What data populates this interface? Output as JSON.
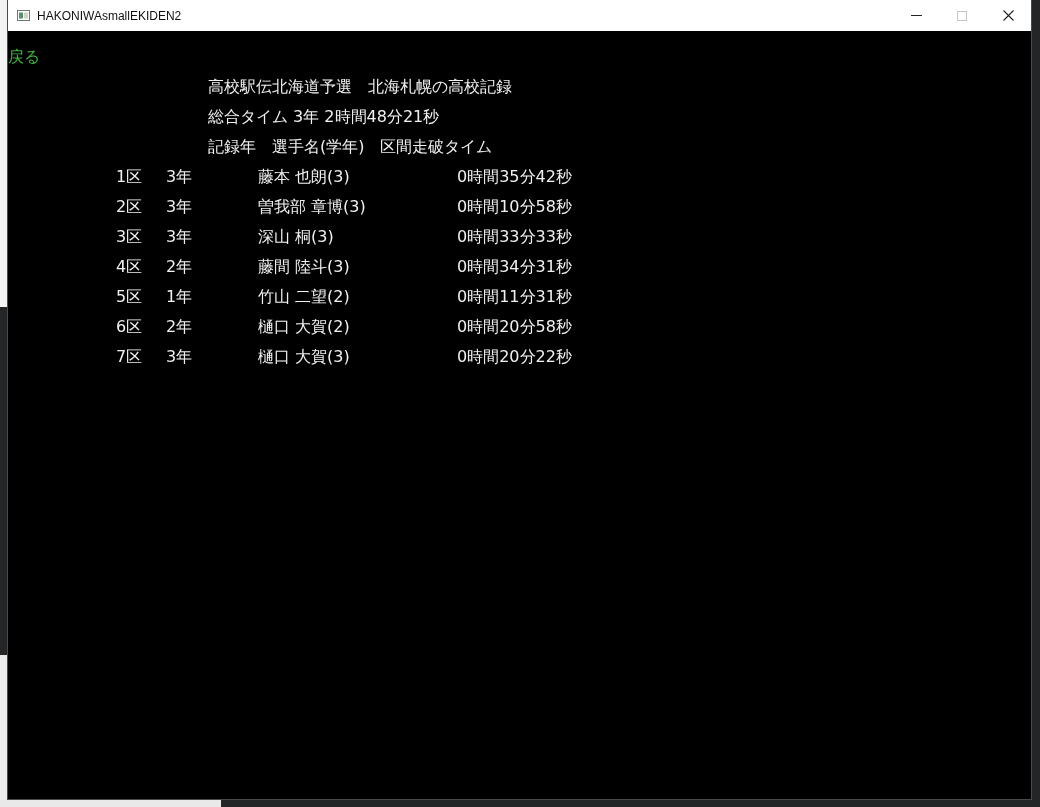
{
  "window": {
    "title": "HAKONIWAsmallEKIDEN2",
    "maximize_disabled": true
  },
  "back_link": "戻る",
  "header": {
    "title": "高校駅伝北海道予選　北海札幌の高校記録",
    "total": "総合タイム 3年 2時間48分21秒",
    "columns": "記録年　選手名(学年)　区間走破タイム"
  },
  "rows": [
    {
      "section": "1区",
      "grade": "3年",
      "runner": "藤本 也朗(3)",
      "time": "0時間35分42秒"
    },
    {
      "section": "2区",
      "grade": "3年",
      "runner": "曽我部 章博(3)",
      "time": "0時間10分58秒"
    },
    {
      "section": "3区",
      "grade": "3年",
      "runner": "深山 桐(3)",
      "time": "0時間33分33秒"
    },
    {
      "section": "4区",
      "grade": "2年",
      "runner": "藤間 陸斗(3)",
      "time": "0時間34分31秒"
    },
    {
      "section": "5区",
      "grade": "1年",
      "runner": "竹山 二望(2)",
      "time": "0時間11分31秒"
    },
    {
      "section": "6区",
      "grade": "2年",
      "runner": "樋口 大賀(2)",
      "time": "0時間20分58秒"
    },
    {
      "section": "7区",
      "grade": "3年",
      "runner": "樋口 大賀(3)",
      "time": "0時間20分22秒"
    }
  ]
}
